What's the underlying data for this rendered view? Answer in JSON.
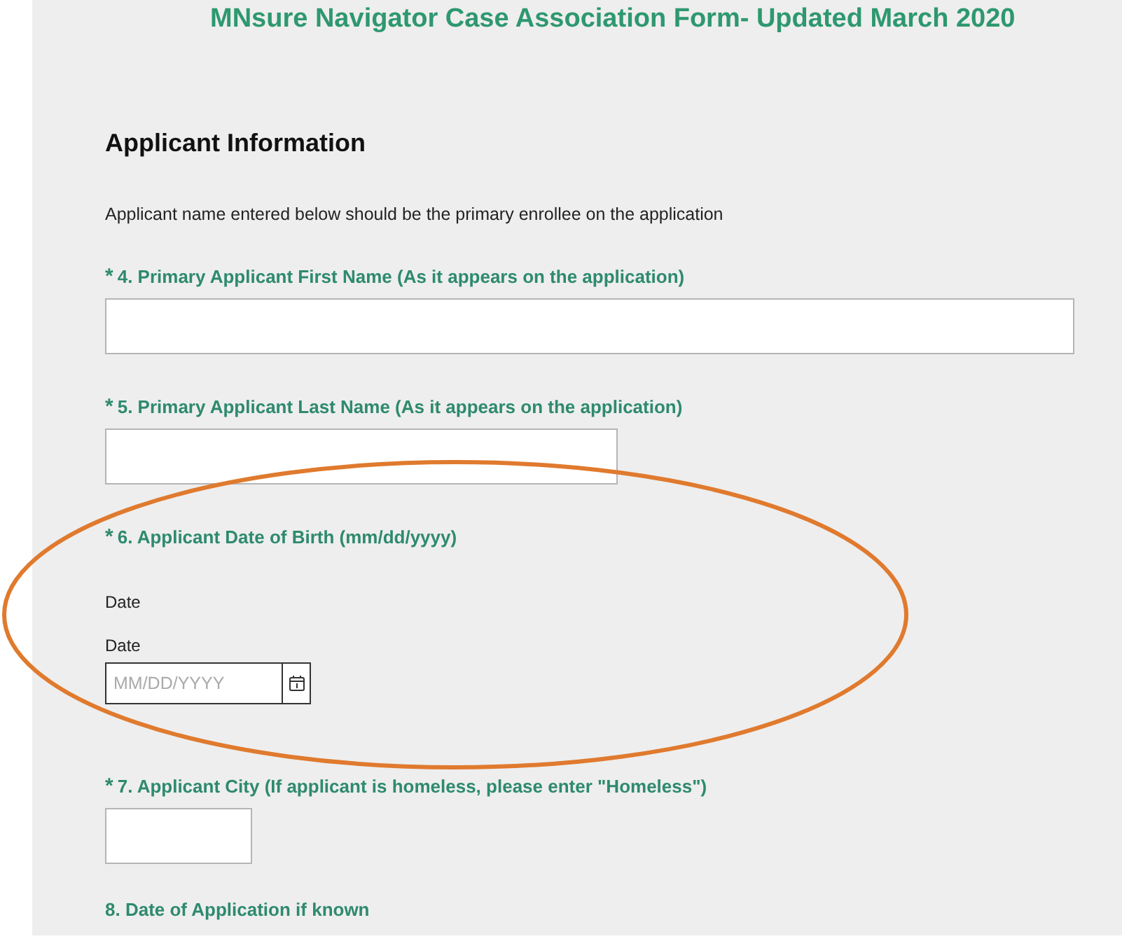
{
  "form_title": "MNsure Navigator Case Association Form- Updated March 2020",
  "section": {
    "heading": "Applicant Information",
    "intro": "Applicant name entered below should be the primary enrollee on the application"
  },
  "questions": [
    {
      "kind": "text",
      "marker": "*",
      "label": "4. Primary Applicant First Name (As it appears on the application)"
    },
    {
      "kind": "text",
      "marker": "*",
      "label": "5. Primary Applicant Last Name (As it appears on the application)"
    },
    {
      "kind": "date",
      "marker": "*",
      "label": "6. Applicant Date of Birth (mm/dd/yyyy)",
      "sublabels": [
        "Date",
        "Date"
      ],
      "placeholder": "MM/DD/YYYY"
    },
    {
      "kind": "text",
      "marker": "*",
      "label": "7. Applicant City (If applicant is homeless, please enter \"Homeless\")"
    },
    {
      "kind": "heading",
      "label": "8. Date of Application if known"
    }
  ]
}
